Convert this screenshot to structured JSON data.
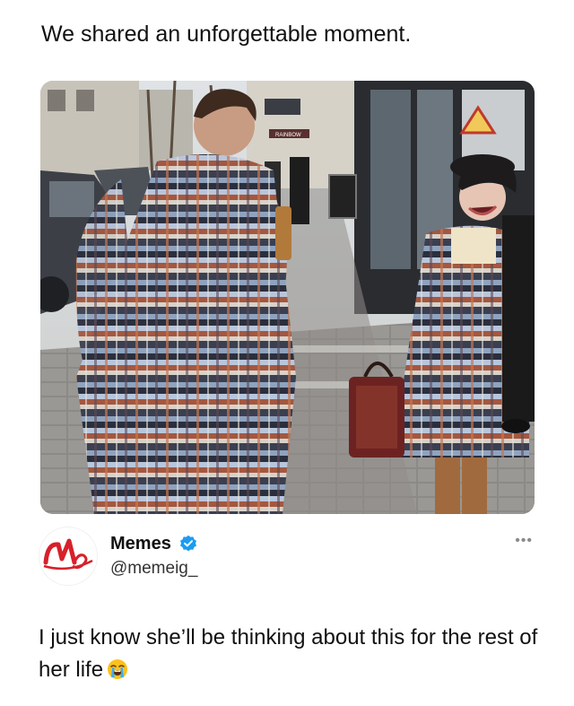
{
  "caption": "We shared an unforgettable moment.",
  "photo": {
    "description_icon": "photo-image",
    "sign_text": "RAINBOW"
  },
  "author": {
    "display_name": "Memes",
    "handle": "@memeig_",
    "verified": true,
    "avatar_logo_text": "Memes",
    "more_label": "•••"
  },
  "post": {
    "text": "I just know she’ll be thinking about this for the rest of her life",
    "emoji": "loudly-crying-face-icon"
  },
  "colors": {
    "verified_blue": "#1d9bf0",
    "avatar_red": "#d8202a",
    "text": "#111111",
    "muted": "#8a8a8a"
  }
}
